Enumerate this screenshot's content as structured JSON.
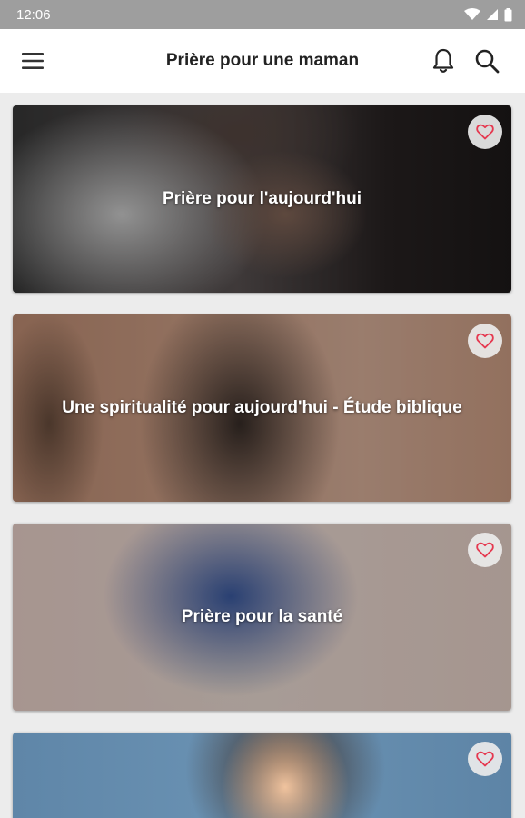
{
  "status_bar": {
    "time": "12:06"
  },
  "app_bar": {
    "title": "Prière pour une maman"
  },
  "cards": [
    {
      "title": "Prière pour l'aujourd'hui"
    },
    {
      "title": "Une spiritualité pour aujourd'hui - Étude biblique"
    },
    {
      "title": "Prière pour la santé"
    },
    {
      "title": ""
    }
  ],
  "icons": {
    "menu": "hamburger-menu-icon",
    "bell": "bell-icon",
    "search": "search-icon",
    "favorite": "heart-outline-icon"
  },
  "colors": {
    "accent": "#e53950",
    "app_bar": "#ffffff",
    "status_bar": "#9e9e9e",
    "background": "#ececec"
  }
}
